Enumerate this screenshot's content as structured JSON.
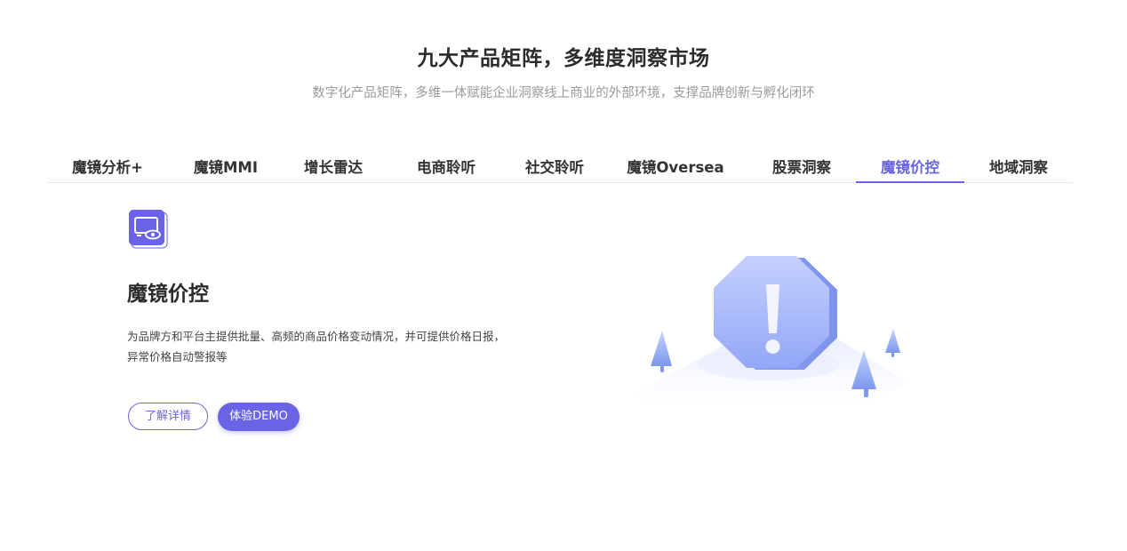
{
  "section": {
    "title": "九大产品矩阵，多维度洞察市场",
    "subtitle": "数字化产品矩阵，多维一体赋能企业洞察线上商业的外部环境，支撑品牌创新与孵化闭环"
  },
  "tabs": [
    {
      "label": "魔镜分析+",
      "active": false
    },
    {
      "label": "魔镜MMI",
      "active": false
    },
    {
      "label": "增长雷达",
      "active": false
    },
    {
      "label": "电商聆听",
      "active": false
    },
    {
      "label": "社交聆听",
      "active": false
    },
    {
      "label": "魔镜Oversea",
      "active": false
    },
    {
      "label": "股票洞察",
      "active": false
    },
    {
      "label": "魔镜价控",
      "active": true
    },
    {
      "label": "地域洞察",
      "active": false
    }
  ],
  "product": {
    "icon": "monitor-eye-icon",
    "title": "魔镜价控",
    "description": "为品牌方和平台主提供批量、高频的商品价格变动情况，并可提供价格日报，异常价格自动警报等",
    "learn_more_label": "了解详情",
    "demo_label": "体验DEMO",
    "illustration": "warning-octagon-illustration"
  },
  "colors": {
    "accent": "#6a63e6",
    "title": "#2b2b2b",
    "subtitle": "#9a9a9a"
  }
}
